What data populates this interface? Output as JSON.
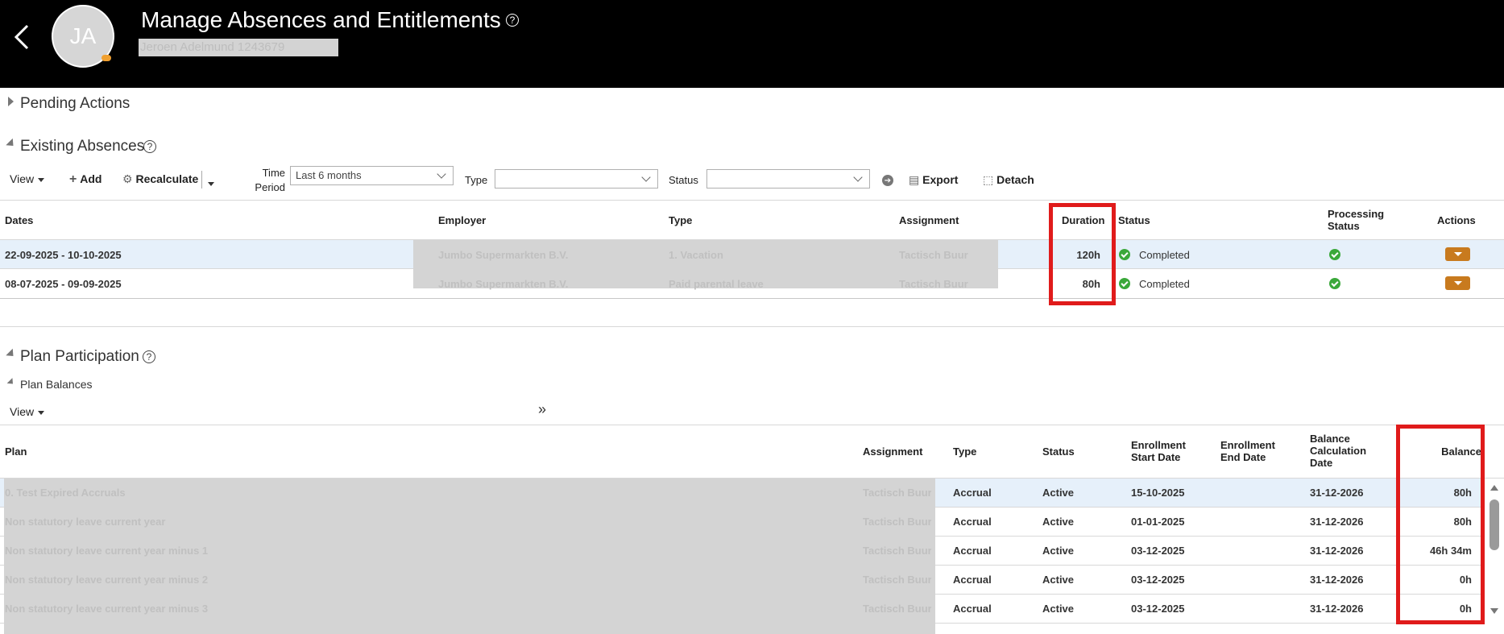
{
  "header": {
    "title": "Manage Absences and Entitlements",
    "help": "?",
    "avatar_initials": "JA",
    "person_name": "Jeroen Adelmund 1243679"
  },
  "pending": {
    "title": "Pending Actions"
  },
  "absences": {
    "title": "Existing Absences",
    "toolbar": {
      "view": "View",
      "add": "Add",
      "recalculate": "Recalculate",
      "time_period_label": "Time Period",
      "time_period_value": "Last 6 months",
      "type_label": "Type",
      "type_value": "",
      "status_label": "Status",
      "status_value": "",
      "export": "Export",
      "detach": "Detach"
    },
    "columns": {
      "dates": "Dates",
      "employer": "Employer",
      "type": "Type",
      "assignment": "Assignment",
      "duration": "Duration",
      "status": "Status",
      "processing_status": "Processing Status",
      "actions": "Actions"
    },
    "rows": [
      {
        "dates": "22-09-2025 - 10-10-2025",
        "employer": "Jumbo Supermarkten B.V.",
        "type": "1. Vacation",
        "assignment": "Tactisch Buur",
        "duration": "120h",
        "status": "Completed"
      },
      {
        "dates": "08-07-2025 - 09-09-2025",
        "employer": "Jumbo Supermarkten B.V.",
        "type": "Paid parental leave",
        "assignment": "Tactisch Buur",
        "duration": "80h",
        "status": "Completed"
      }
    ]
  },
  "plans": {
    "title": "Plan Participation",
    "subtitle": "Plan Balances",
    "view": "View",
    "columns": {
      "plan": "Plan",
      "assignment": "Assignment",
      "type": "Type",
      "status": "Status",
      "enroll_start": "Enrollment Start Date",
      "enroll_end": "Enrollment End Date",
      "balance_calc": "Balance Calculation Date",
      "balance": "Balance"
    },
    "rows": [
      {
        "plan": "0. Test Expired Accruals",
        "assignment": "Tactisch Buur",
        "type": "Accrual",
        "status": "Active",
        "start": "15-10-2025",
        "end": "",
        "calc": "31-12-2026",
        "balance": "80h"
      },
      {
        "plan": "Non statutory leave current year",
        "assignment": "Tactisch Buur",
        "type": "Accrual",
        "status": "Active",
        "start": "01-01-2025",
        "end": "",
        "calc": "31-12-2026",
        "balance": "80h"
      },
      {
        "plan": "Non statutory leave current year minus 1",
        "assignment": "Tactisch Buur",
        "type": "Accrual",
        "status": "Active",
        "start": "03-12-2025",
        "end": "",
        "calc": "31-12-2026",
        "balance": "46h 34m"
      },
      {
        "plan": "Non statutory leave current year minus 2",
        "assignment": "Tactisch Buur",
        "type": "Accrual",
        "status": "Active",
        "start": "03-12-2025",
        "end": "",
        "calc": "31-12-2026",
        "balance": "0h"
      },
      {
        "plan": "Non statutory leave current year minus 3",
        "assignment": "Tactisch Buur",
        "type": "Accrual",
        "status": "Active",
        "start": "03-12-2025",
        "end": "",
        "calc": "31-12-2026",
        "balance": "0h"
      }
    ]
  },
  "colors": {
    "header_bg": "#000000",
    "highlight_row": "#e6f0fa",
    "accent_orange": "#c87a1e",
    "success_green": "#3aa83a",
    "annotation_red": "#e01b1b"
  }
}
